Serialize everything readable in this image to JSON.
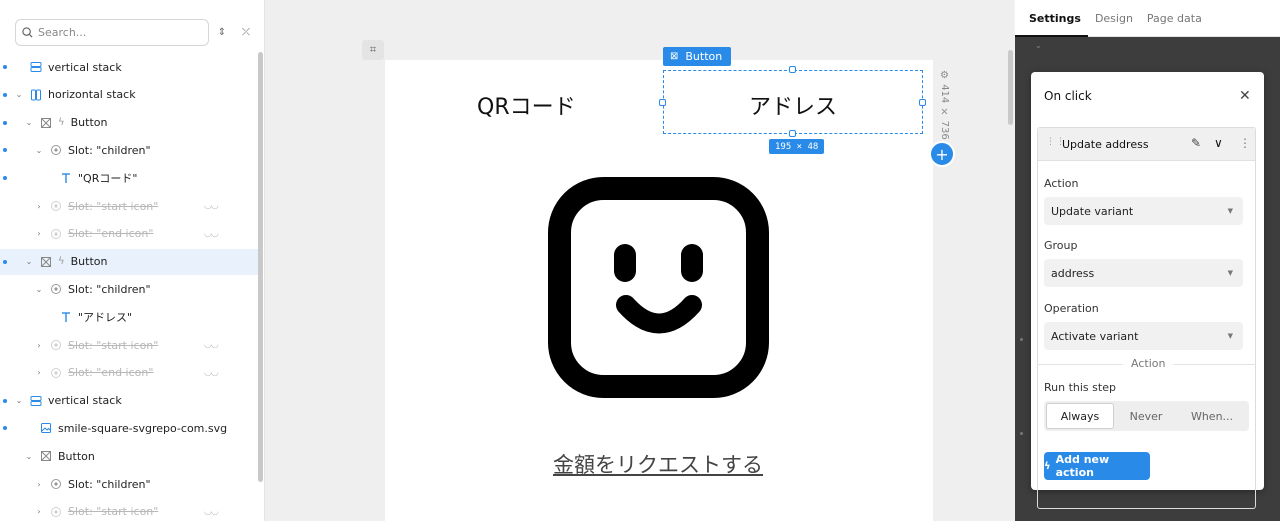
{
  "layers": {
    "search_placeholder": "Search...",
    "rows": [
      {
        "label": "vertical stack",
        "icon": "vertical-stack-icon",
        "dim": false
      },
      {
        "label": "horizontal stack",
        "icon": "horizontal-stack-icon",
        "dim": false
      },
      {
        "label": "Button",
        "icon": "button-component-icon",
        "dim": false
      },
      {
        "label": "Slot: \"children\"",
        "icon": "slot-icon",
        "dim": false
      },
      {
        "label": "\"QRコード\"",
        "icon": "text-icon",
        "dim": false
      },
      {
        "label": "Slot: \"start icon\"",
        "icon": "slot-icon",
        "dim": true
      },
      {
        "label": "Slot: \"end icon\"",
        "icon": "slot-icon",
        "dim": true
      },
      {
        "label": "Button",
        "icon": "button-component-icon",
        "dim": false
      },
      {
        "label": "Slot: \"children\"",
        "icon": "slot-icon",
        "dim": false
      },
      {
        "label": "\"アドレス\"",
        "icon": "text-icon",
        "dim": false
      },
      {
        "label": "Slot: \"start icon\"",
        "icon": "slot-icon",
        "dim": true
      },
      {
        "label": "Slot: \"end icon\"",
        "icon": "slot-icon",
        "dim": true
      },
      {
        "label": "vertical stack",
        "icon": "vertical-stack-icon",
        "dim": false
      },
      {
        "label": "smile-square-svgrepo-com.svg",
        "icon": "image-icon",
        "dim": false
      },
      {
        "label": "Button",
        "icon": "button-component-icon",
        "dim": false
      },
      {
        "label": "Slot: \"children\"",
        "icon": "slot-icon",
        "dim": false
      },
      {
        "label": "Slot: \"start icon\"",
        "icon": "slot-icon",
        "dim": true
      }
    ]
  },
  "canvas": {
    "qr_button_label": "QRコード",
    "address_button_label": "アドレス",
    "selection_tag": "Button",
    "selection_size": "195 × 48",
    "frame_size": "414 × 736",
    "request_link": "金額をリクエストする",
    "add_label": "+"
  },
  "panel": {
    "tabs": [
      "Settings",
      "Design",
      "Page data"
    ],
    "popup_title": "On click",
    "step_title": "Update address",
    "action_label": "Action",
    "action_value": "Update variant",
    "group_label": "Group",
    "group_value": "address",
    "operation_label": "Operation",
    "operation_value": "Activate variant",
    "divider_label": "Action",
    "run_label": "Run this step",
    "run_options": [
      "Always",
      "Never",
      "When..."
    ],
    "run_selected": "Always",
    "add_new_action": "Add new action"
  },
  "colors": {
    "accent": "#2a8ae8",
    "panel_dark": "#3d3d3d"
  }
}
